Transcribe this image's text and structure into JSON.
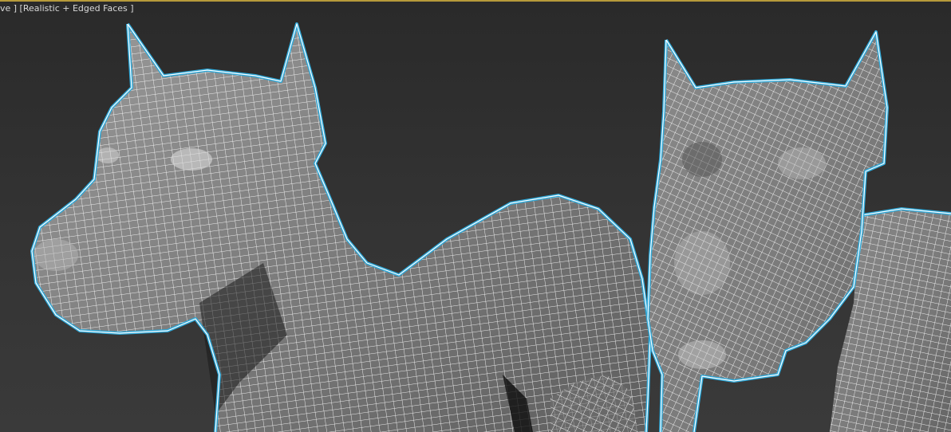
{
  "viewport": {
    "label": "ve ] [Realistic + Edged Faces ]",
    "border_color": "#b79a3a",
    "selection_outline_color": "#2ea8d8",
    "wire_color": "#ffffff"
  }
}
